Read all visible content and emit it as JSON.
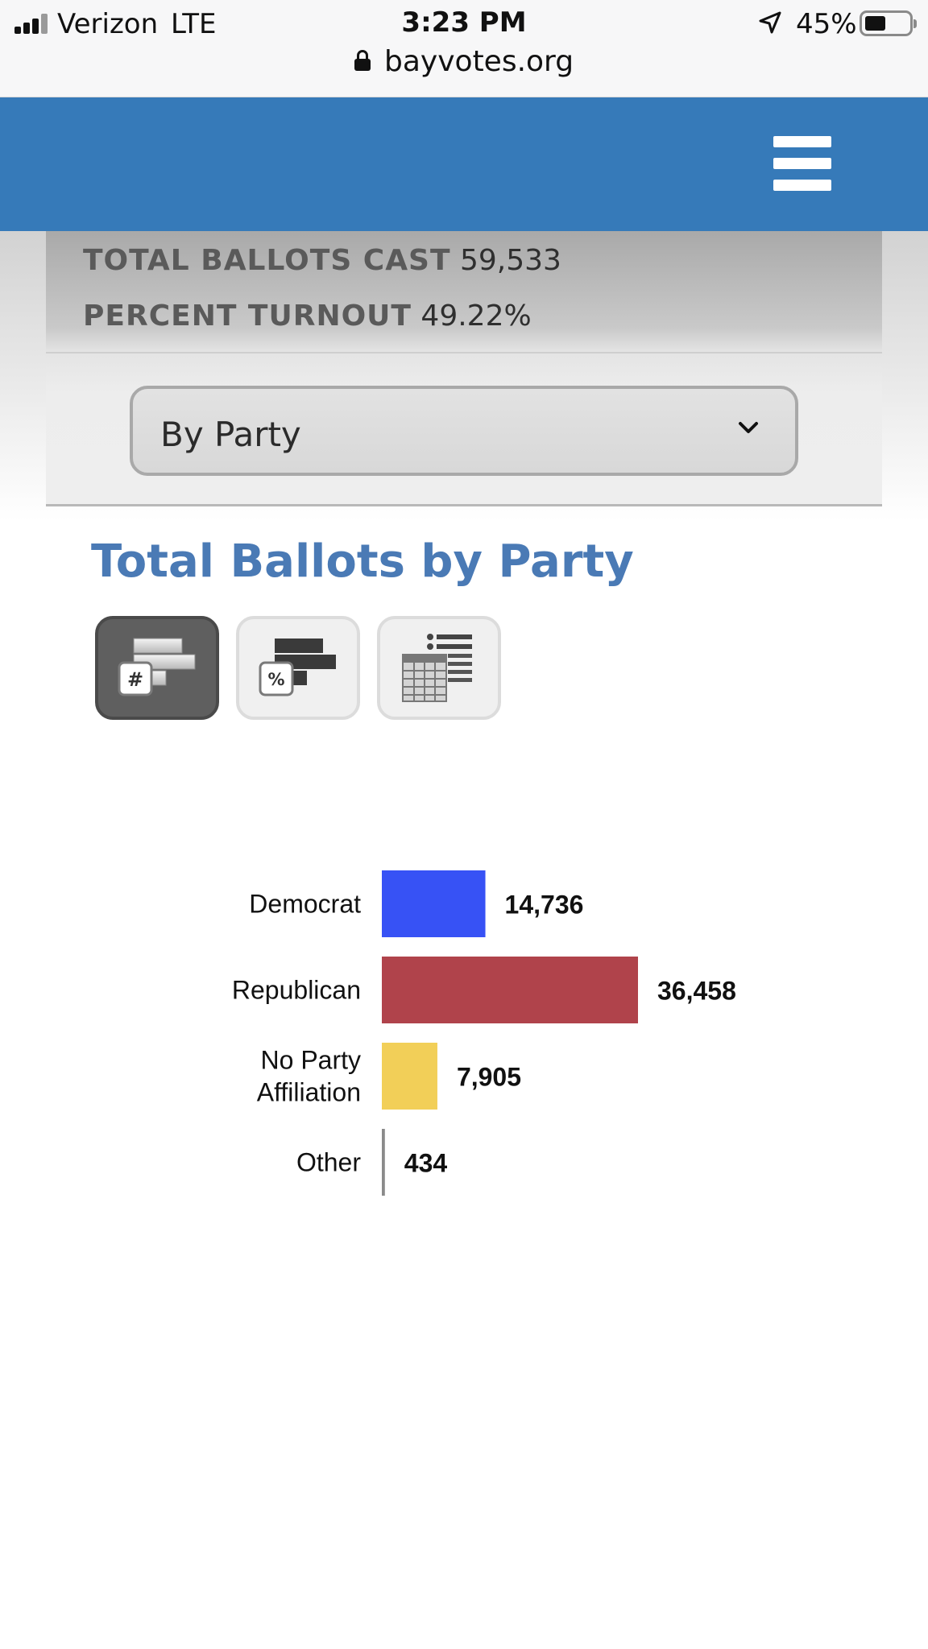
{
  "status_bar": {
    "carrier": "Verizon",
    "network": "LTE",
    "time": "3:23 PM",
    "battery_percent": "45%",
    "battery_level": 0.45,
    "icons": [
      "signal-icon",
      "location-arrow-icon",
      "battery-icon"
    ]
  },
  "browser": {
    "url": "bayvotes.org",
    "icons": [
      "lock-icon"
    ]
  },
  "header": {
    "menu_icon": "hamburger-menu-icon",
    "background_color": "#367ab9"
  },
  "summary": {
    "ballots_label": "TOTAL BALLOTS CAST",
    "ballots_value": "59,533",
    "turnout_label": "PERCENT TURNOUT",
    "turnout_value": "49.22%"
  },
  "filter": {
    "selected": "By Party",
    "icon": "chevron-down-icon"
  },
  "chart_title": "Total Ballots by Party",
  "view_buttons": [
    {
      "icon": "count-bar-chart-icon",
      "active": true
    },
    {
      "icon": "percent-bar-chart-icon",
      "active": false
    },
    {
      "icon": "table-view-icon",
      "active": false
    }
  ],
  "chart_data": {
    "type": "bar",
    "orientation": "horizontal",
    "title": "",
    "categories": [
      "Democrat",
      "Republican",
      "No Party Affiliation",
      "Other"
    ],
    "category_lines": [
      [
        "Democrat"
      ],
      [
        "Republican"
      ],
      [
        "No Party",
        "Affiliation"
      ],
      [
        "Other"
      ]
    ],
    "values": [
      14736,
      36458,
      7905,
      434
    ],
    "value_labels": [
      "14,736",
      "36,458",
      "7,905",
      "434"
    ],
    "colors": [
      "#3752f5",
      "#b0434b",
      "#f2cf58",
      "#8a8a8a"
    ],
    "xlim": [
      0,
      50000
    ],
    "grid": false
  }
}
